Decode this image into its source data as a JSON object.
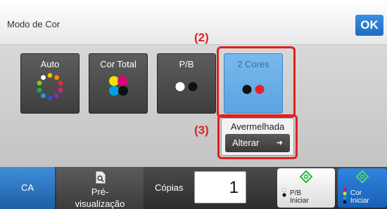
{
  "header": {
    "title": "Modo de Cor",
    "ok_label": "OK"
  },
  "modes": [
    {
      "label": "Auto",
      "icon": "color-wheel-icon"
    },
    {
      "label": "Cor Total",
      "icon": "cmyk-dots-icon"
    },
    {
      "label": "P/B",
      "icon": "black-white-dots-icon"
    },
    {
      "label": "2 Cores",
      "icon": "two-color-dots-icon",
      "selected": true
    }
  ],
  "callouts": {
    "step2": "(2)",
    "step3": "(3)"
  },
  "two_color": {
    "selected_color": "Avermelhada",
    "change_label": "Alterar"
  },
  "bottom": {
    "ca_label": "CA",
    "preview_line1": "Pré-",
    "preview_line2": "visualização",
    "copies_label": "Cópias",
    "copies_value": "1",
    "start_bw_line1": "P/B",
    "start_bw_line2": "Iniciar",
    "start_color_line1": "Cor",
    "start_color_line2": "Iniciar"
  },
  "colors": {
    "accent_blue": "#1f6ac0",
    "callout_red": "#e02020",
    "selected_mode": "#6aaee8"
  }
}
